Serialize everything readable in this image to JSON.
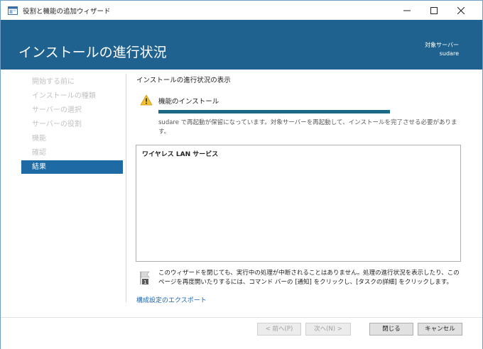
{
  "window": {
    "title": "役割と機能の追加ウィザード",
    "minimize_glyph": "—",
    "maximize_glyph": "☐",
    "close_glyph": "✕"
  },
  "header": {
    "page_title": "インストールの進行状況",
    "target_label": "対象サーバー",
    "target_name": "sudare"
  },
  "sidebar": {
    "items": [
      {
        "label": "開始する前に",
        "active": false
      },
      {
        "label": "インストールの種類",
        "active": false
      },
      {
        "label": "サーバーの選択",
        "active": false
      },
      {
        "label": "サーバーの役割",
        "active": false
      },
      {
        "label": "機能",
        "active": false
      },
      {
        "label": "確認",
        "active": false
      },
      {
        "label": "結果",
        "active": true
      }
    ]
  },
  "content": {
    "heading": "インストールの進行状況の表示",
    "feature_status_label": "機能のインストール",
    "progress": 1.0,
    "pending_message": "sudare で再起動が保留になっています。対象サーバーを再起動して、インストールを完了させる必要があります。",
    "results": [
      "ワイヤレス LAN サービス"
    ],
    "info_text": "このウィザードを閉じても、実行中の処理が中断されることはありません。処理の進行状況を表示したり、このページを再度開いたりするには、コマンド バーの [通知] をクリックし、[タスクの詳細] をクリックします。",
    "info_icon_badge": "1",
    "export_link": "構成設定のエクスポート"
  },
  "footer": {
    "prev_label": "< 前へ(P)",
    "next_label": "次へ(N) >",
    "close_label": "閉じる",
    "cancel_label": "キャンセル"
  },
  "colors": {
    "banner": "#20628f",
    "active_nav": "#1e6aa4",
    "progress": "#1c6a85",
    "link": "#1a64b4",
    "warning": "#f2c22f"
  },
  "icons": {
    "app": "server-manager-icon",
    "warning": "warning-icon",
    "info": "notification-flag-icon"
  }
}
